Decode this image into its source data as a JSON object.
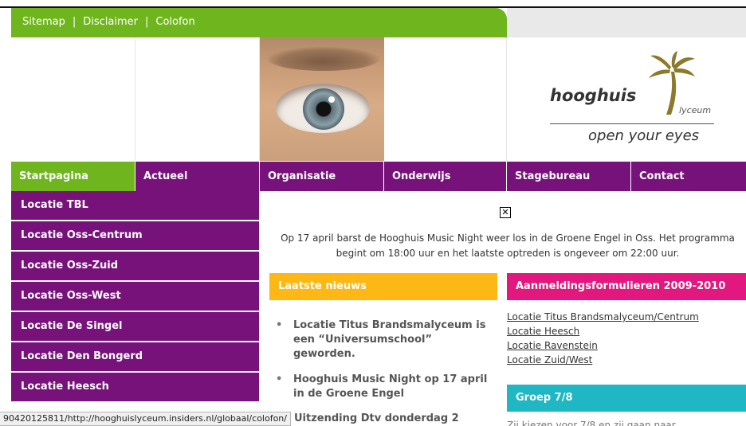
{
  "topnav": {
    "sitemap": "Sitemap",
    "sep1": "|",
    "disclaimer": "Disclaimer",
    "sep2": "|",
    "colofon": "Colofon"
  },
  "logo": {
    "name": "hooghuis",
    "sub": "lyceum",
    "tagline": "open your eyes"
  },
  "mainnav": [
    {
      "label": "Startpagina",
      "active": true
    },
    {
      "label": "Actueel"
    },
    {
      "label": "Organisatie"
    },
    {
      "label": "Onderwijs"
    },
    {
      "label": "Stagebureau"
    },
    {
      "label": "Contact"
    }
  ],
  "sidebar": [
    {
      "label": "Locatie TBL"
    },
    {
      "label": "Locatie Oss-Centrum"
    },
    {
      "label": "Locatie Oss-Zuid"
    },
    {
      "label": "Locatie Oss-West"
    },
    {
      "label": "Locatie De Singel"
    },
    {
      "label": "Locatie Den Bongerd"
    },
    {
      "label": "Locatie Heesch"
    }
  ],
  "notice": "Op 17 april barst de Hooghuis Music Night weer los in de Groene Engel in Oss. Het programma begint om 18:00 uur en het laatste optreden is ongeveer om 22:00 uur.",
  "news": {
    "title": "Laatste nieuws",
    "items": [
      "Locatie Titus Brandsmalyceum is een “Universumschool” geworden.",
      "Hooghuis Music Night op 17 april in de Groene Engel"
    ],
    "partial": "Uitzending Dtv donderdag 2"
  },
  "forms": {
    "title": "Aanmeldingsformulieren 2009-2010",
    "links": [
      "Locatie Titus Brandsmalyceum/Centrum",
      "Locatie Heesch",
      "Locatie Ravenstein",
      "Locatie Zuid/West"
    ]
  },
  "group": {
    "title": "Groep 7/8",
    "partial": "Zij kiezen voor 7/8 en zij gaan naar"
  },
  "status": "90420125811/http://hooghuislyceum.insiders.nl/globaal/colofon/",
  "colors": {
    "green": "#6fb61e",
    "purple": "#77127a",
    "orange": "#fdb816",
    "pink": "#e3187e",
    "teal": "#1fb7c3"
  }
}
